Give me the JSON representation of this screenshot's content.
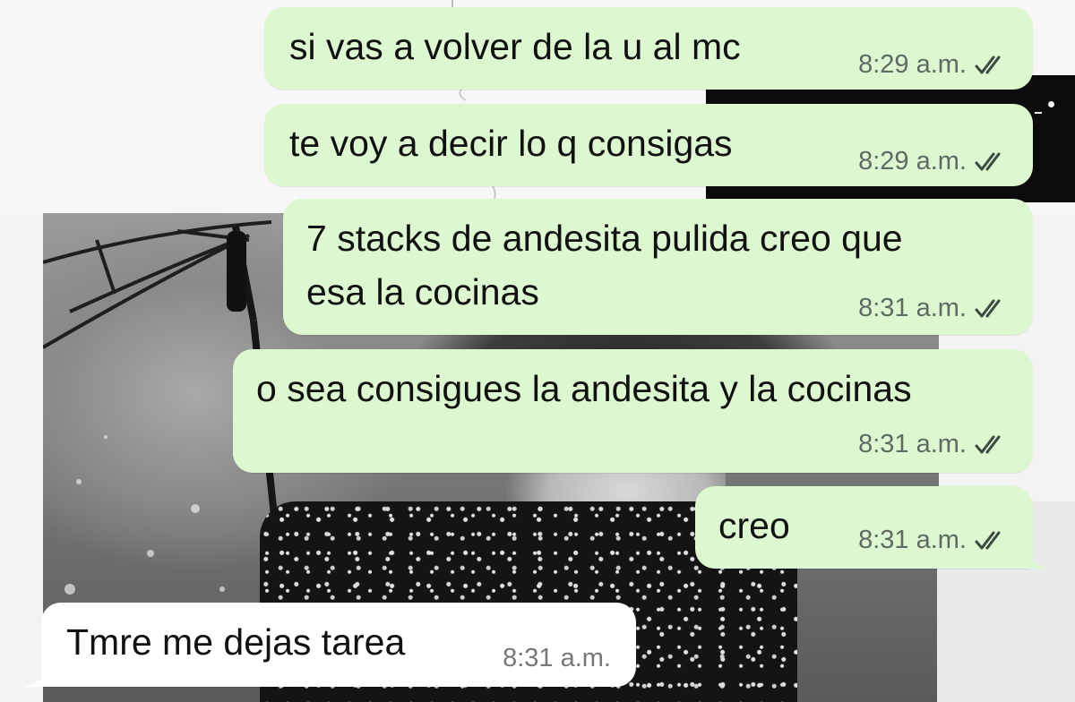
{
  "chat": {
    "messages": [
      {
        "direction": "outgoing",
        "text": "si vas a volver de la u al mc",
        "time": "8:29 a.m.",
        "status": "read"
      },
      {
        "direction": "outgoing",
        "text": "te voy a decir lo q consigas",
        "time": "8:29 a.m.",
        "status": "read"
      },
      {
        "direction": "outgoing",
        "text": "7 stacks de andesita pulida creo que",
        "text_line2": "esa la cocinas",
        "time": "8:31 a.m.",
        "status": "read"
      },
      {
        "direction": "outgoing",
        "text": "o sea consigues la andesita y la cocinas",
        "time": "8:31 a.m.",
        "status": "read"
      },
      {
        "direction": "outgoing",
        "text": "creo",
        "time": "8:31 a.m.",
        "status": "read"
      },
      {
        "direction": "incoming",
        "text": "Tmre me dejas tarea",
        "time": "8:31 a.m."
      }
    ]
  },
  "theme": {
    "outgoing_bubble_color": "#ddf8d0",
    "incoming_bubble_color": "#ffffff",
    "read_tick_color": "#3b4a40",
    "tick_icon": "double-check-icon"
  }
}
